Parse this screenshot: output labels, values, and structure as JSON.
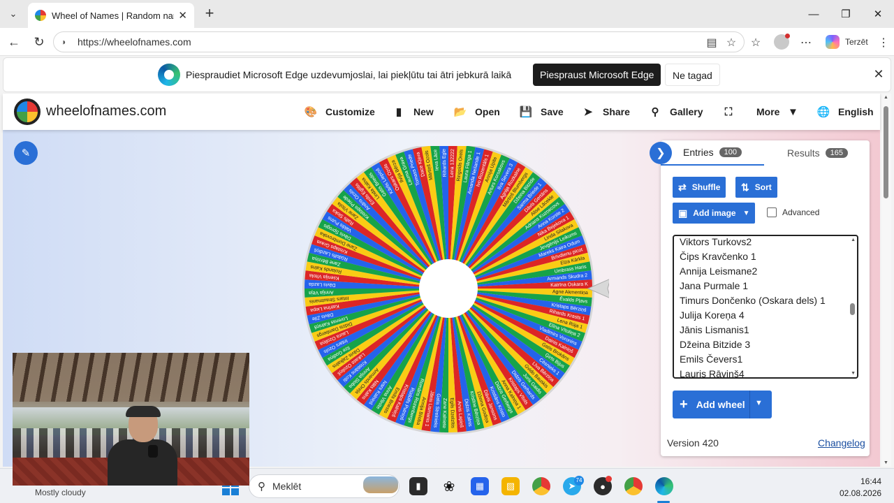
{
  "browser": {
    "tab_title": "Wheel of Names | Random name p",
    "url": "https://wheelofnames.com",
    "copilot_label": "Terzēt"
  },
  "infobar": {
    "message": "Piespraudiet Microsoft Edge uzdevumjoslai, lai piekļūtu tai ātri jebkurā laikā",
    "pin_label": "Piespraust Microsoft Edge",
    "not_now_label": "Ne tagad"
  },
  "site": {
    "name": "wheelofnames.com",
    "nav": [
      {
        "label": "Customize",
        "icon": "palette-icon"
      },
      {
        "label": "New",
        "icon": "file-icon"
      },
      {
        "label": "Open",
        "icon": "folder-icon"
      },
      {
        "label": "Save",
        "icon": "save-icon"
      },
      {
        "label": "Share",
        "icon": "share-icon"
      },
      {
        "label": "Gallery",
        "icon": "search-icon"
      },
      {
        "label": "",
        "icon": "fullscreen-icon"
      },
      {
        "label": "More",
        "icon": "chevron-down-icon"
      },
      {
        "label": "English",
        "icon": "globe-icon"
      }
    ]
  },
  "panel": {
    "tabs": [
      {
        "label": "Entries",
        "count": "100"
      },
      {
        "label": "Results",
        "count": "165"
      }
    ],
    "shuffle_label": "Shuffle",
    "sort_label": "Sort",
    "add_image_label": "Add image",
    "advanced_label": "Advanced",
    "advanced_checked": false,
    "entries": [
      "Viktors Turkovs2",
      "Čips Kravčenko 1",
      "Annija Leismane2",
      "Jana Purmale 1",
      "Timurs Dončenko (Oskara dels) 1",
      "Julija Koreņa 4",
      "Jānis Lismanis1",
      "Džeina Bitzide 3",
      "Emils Čevers1",
      "Lauris Rāviņš4"
    ],
    "add_wheel_label": "Add wheel",
    "version": "Version 420",
    "changelog": "Changelog"
  },
  "wheel": {
    "slice_colors": [
      "#dc2626",
      "#facc15",
      "#16a34a",
      "#2563eb"
    ],
    "slice_count": 100,
    "labels": [
      "Lena 132222",
      "Ringolds Orels",
      "Laura Filinga 1",
      "Amanda Neilande 1",
      "Ivo Rozentāls 1",
      "Annija Upīte",
      "Arturs Korsakovs",
      "Ilva Severa 3",
      "Agnija Rozkalne",
      "Mārtiņš Blumbergs",
      "Džeina Bitzide",
      "Sarma Briede 1",
      "Dāvis Gertāns",
      "Alise Lācekle",
      "Adrians Kuzņecovs",
      "Anna Korste 2",
      "Nika Bejekova 1",
      "Linda Silakova",
      "Jevgēnijs Leikums",
      "Mareks Kaira Odum",
      "Brīvdienu picot",
      "Elza Kārkla",
      "Umbrass Haris",
      "Armands Skudra 2",
      "Katrīna Oskara K",
      "Agne Akmentiņa",
      "Ēvalds Pļavs",
      "Kristaps Bērziņš",
      "Rihards Krasts 1",
      "Lena Rūja 1",
      "Elīna Vītoliņa 2",
      "Vladimirs Voronins",
      "Dainis Kalniņš",
      "Gatis Brokāns",
      "Ģirts Bijus",
      "Cēsnieks 1",
      "Līva Bērziņa",
      "Gvido Bauskis",
      "Juris Gaidis",
      "Didzis Gerhards",
      "Kristaps Vītols",
      "Anna Kalniņa 1",
      "Didzis Gerbergs",
      "Kristiāns Kristo",
      "Dāvis Jansons",
      "Džeina Godiņa",
      "Kristīne Bērziņa",
      "Didzis Kalnis",
      "Arvis Lapiņš",
      "Egils Dzelzītis",
      "Zane Kalniete",
      "Gatis Strelnieks",
      "Jānis Lismanis 1",
      "Annija Biloba",
      "Romāns Rozenbergs",
      "Rūdolfs Putniņš",
      "Kristaps Kalniņš",
      "Emīls Briests",
      "Anna Vilnīte",
      "Ivars Kalniņš",
      "Nāts Kalns",
      "Armands Oreļa",
      "Annija Sloba",
      "Kristiāns Koši",
      "Lukass Ozoliņš",
      "Dāvis Zaļkalns",
      "Ilze Godiņa",
      "Intars Ozols",
      "Laura Ozoliņa",
      "Didzis Dambergs",
      "Lorenss Kalniņš",
      "Dāvis Zīle",
      "Katrīna Liepa",
      "Intars Strautmanis",
      "Annija Vēja",
      "Dāvis Lazda",
      "Ksenija Vītola",
      "Rolands Kalns",
      "Zane Bērziņa",
      "Rūdolfs Lazdiņš",
      "Kristaps Grava",
      "Zane Dombrovska",
      "Dāvis Sprogis",
      "Valdis Putns",
      "Ralfs Sloka",
      "Zane Vītola",
      "Kristaps Priede",
      "Andris Ozols",
      "Emīls Eglītis",
      "Linda Kalna",
      "Gatis Briedis",
      "Kārlis Liepiņš",
      "Oskars Ozols",
      "Ilvija Bērza",
      "Lauma Grava",
      "Tomass Priede",
      "Dace Kļava",
      "Mārtiņš Ozols",
      "Ieva Lāce",
      "Rihards Egle"
    ]
  },
  "taskbar": {
    "weather": "Mostly cloudy",
    "search_placeholder": "Meklēt",
    "notification_count": "74",
    "time": "16:44",
    "date": "02.08.2026"
  }
}
